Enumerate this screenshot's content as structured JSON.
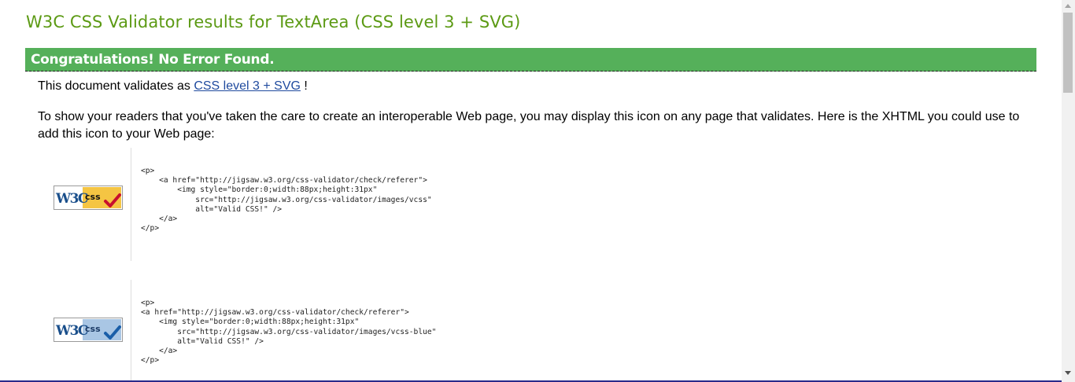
{
  "header": {
    "title": "W3C CSS Validator results for TextArea (CSS level 3 + SVG)"
  },
  "result": {
    "banner": "Congratulations! No Error Found."
  },
  "body": {
    "validates_prefix": "This document validates as",
    "validates_link": "CSS level 3 + SVG",
    "validates_suffix": "!",
    "icon_paragraph": "To show your readers that you've taken the care to create an interoperable Web page, you may display this icon on any page that validates. Here is the XHTML you could use to add this icon to your Web page:"
  },
  "badges": [
    {
      "w3c_text": "W3C",
      "css_text": "css",
      "color": "#f5c543",
      "check_color": "#c8102e",
      "code": "<p>\n    <a href=\"http://jigsaw.w3.org/css-validator/check/referer\">\n        <img style=\"border:0;width:88px;height:31px\"\n            src=\"http://jigsaw.w3.org/css-validator/images/vcss\"\n            alt=\"Valid CSS!\" />\n    </a>\n</p>"
    },
    {
      "w3c_text": "W3C",
      "css_text": "css",
      "color": "#a9c6e4",
      "check_color": "#1a5ea8",
      "code": "<p>\n<a href=\"http://jigsaw.w3.org/css-validator/check/referer\">\n    <img style=\"border:0;width:88px;height:31px\"\n        src=\"http://jigsaw.w3.org/css-validator/images/vcss-blue\"\n        alt=\"Valid CSS!\" />\n    </a>\n</p>"
    }
  ]
}
